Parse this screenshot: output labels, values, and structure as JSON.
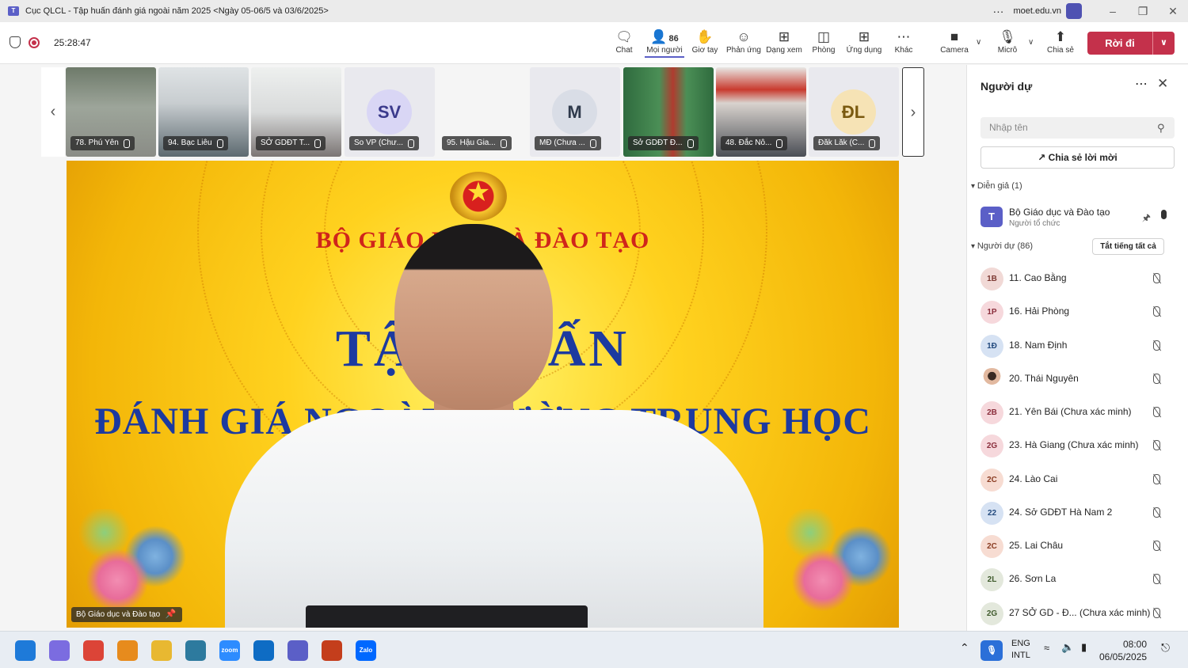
{
  "window": {
    "title": "Cục QLCL - Tập huấn đánh giá ngoài năm 2025 <Ngày 05-06/5 và 03/6/2025>",
    "domain": "moet.edu.vn",
    "more": "···"
  },
  "meeting": {
    "timer": "25:28:47",
    "buttons": [
      {
        "label": "Chat",
        "icon": "chat-icon"
      },
      {
        "label": "Mọi người",
        "icon": "people-icon",
        "count": "86"
      },
      {
        "label": "Giơ tay",
        "icon": "raise-hand-icon"
      },
      {
        "label": "Phản ứng",
        "icon": "emoji-icon"
      },
      {
        "label": "Dạng xem",
        "icon": "grid-view-icon"
      },
      {
        "label": "Phòng",
        "icon": "rooms-icon"
      },
      {
        "label": "Ứng dụng",
        "icon": "add-app-icon"
      },
      {
        "label": "Khác",
        "icon": "more-icon"
      },
      {
        "label": "Camera",
        "icon": "camera-icon"
      },
      {
        "label": "Micrô",
        "icon": "microphone-icon"
      },
      {
        "label": "Chia sẻ",
        "icon": "share-icon"
      }
    ],
    "leave_label": "Rời đi"
  },
  "thumbnails": [
    {
      "name": "78. Phú Yên",
      "kind": "photo"
    },
    {
      "name": "94. Bạc Liêu",
      "kind": "hall"
    },
    {
      "name": "SỞ GDĐT T...",
      "kind": "room"
    },
    {
      "name": "So VP (Chư...",
      "kind": "initials",
      "initials": "SV",
      "color": "#d9d6f5",
      "text_color": "#3b3a8c"
    },
    {
      "name": "95. Hậu Gia...",
      "kind": "blank"
    },
    {
      "name": "MĐ (Chưa ...",
      "kind": "initials",
      "initials": "M",
      "color": "#d9dde6",
      "text_color": "#2f3a4c"
    },
    {
      "name": "Sở GDĐT Đ...",
      "kind": "green"
    },
    {
      "name": "48. Đắc Nô...",
      "kind": "red"
    },
    {
      "name": "Đăk Lăk (C...",
      "kind": "initials",
      "initials": "ĐL",
      "color": "#f6e3b5",
      "text_color": "#7a5a10"
    }
  ],
  "main_video": {
    "banner_line1": "BỘ GIÁO DỤC VÀ ĐÀO TẠO",
    "banner_line2": "TẬP HUẤN",
    "banner_line3": "ĐÁNH GIÁ NGOÀI TRƯỜNG TRUNG HỌC",
    "speaker_label": "Bộ Giáo dục và Đào tạo"
  },
  "panel": {
    "title": "Người dự",
    "search_placeholder": "Nhập tên",
    "invite_label": "Chia sẻ lời mời",
    "presenters_header": "Diễn giả (1)",
    "presenter": {
      "name": "Bộ Giáo dục và Đào tạo",
      "role": "Người tổ chức"
    },
    "attendees_header": "Người dự (86)",
    "mute_all": "Tắt tiếng tất cả",
    "attendees": [
      {
        "initials": "1B",
        "name": "11. Cao Bằng",
        "color": "#f1d9d6",
        "text_color": "#7d3a33"
      },
      {
        "initials": "1P",
        "name": "16. Hải Phòng",
        "color": "#f6d8dc",
        "text_color": "#8a2e3c"
      },
      {
        "initials": "1Đ",
        "name": "18. Nam Định",
        "color": "#d6e2f3",
        "text_color": "#234a7e"
      },
      {
        "initials": "",
        "name": "20. Thái Nguyên",
        "color": "#ead8cf",
        "text_color": "#5a3a2c"
      },
      {
        "initials": "2B",
        "name": "21. Yên Bái (Chưa xác minh)",
        "color": "#f6d8dc",
        "text_color": "#8a2e3c"
      },
      {
        "initials": "2G",
        "name": "23. Hà Giang (Chưa xác minh)",
        "color": "#f6d8dc",
        "text_color": "#8a2e3c"
      },
      {
        "initials": "2C",
        "name": "24. Lào Cai",
        "color": "#f7dcd2",
        "text_color": "#8a3c22"
      },
      {
        "initials": "22",
        "name": "24. Sở GDĐT Hà Nam 2",
        "color": "#d6e2f3",
        "text_color": "#234a7e"
      },
      {
        "initials": "2C",
        "name": "25. Lai Châu",
        "color": "#f7dcd2",
        "text_color": "#8a3c22"
      },
      {
        "initials": "2L",
        "name": "26. Sơn La",
        "color": "#e3e8dc",
        "text_color": "#3f5a2c"
      },
      {
        "initials": "2G",
        "name": "27 SỞ GD - Đ...  (Chưa xác minh)",
        "color": "#e3e8dc",
        "text_color": "#3f5a2c"
      }
    ]
  },
  "taskbar": {
    "apps": [
      {
        "icon": "windows-start-icon",
        "color": "#1e7ad9"
      },
      {
        "icon": "copilot-icon",
        "color": "#7b6ce0"
      },
      {
        "icon": "chrome-icon",
        "color": "#dc4437"
      },
      {
        "icon": "search-icon",
        "color": "#e78b1d"
      },
      {
        "icon": "file-explorer-icon",
        "color": "#e8b831"
      },
      {
        "icon": "remote-desktop-icon",
        "color": "#2d7a9e"
      },
      {
        "icon": "zoom-icon",
        "label": "zoom",
        "color": "#2d8cff"
      },
      {
        "icon": "teamviewer-icon",
        "color": "#0e6cc4"
      },
      {
        "icon": "teams-icon",
        "color": "#5b5fc7"
      },
      {
        "icon": "powerpoint-icon",
        "color": "#c43e1c"
      },
      {
        "icon": "zalo-icon",
        "label": "Zalo",
        "color": "#0068ff"
      }
    ],
    "lang": "ENG",
    "layout": "INTL",
    "time": "08:00",
    "date": "06/05/2025"
  }
}
